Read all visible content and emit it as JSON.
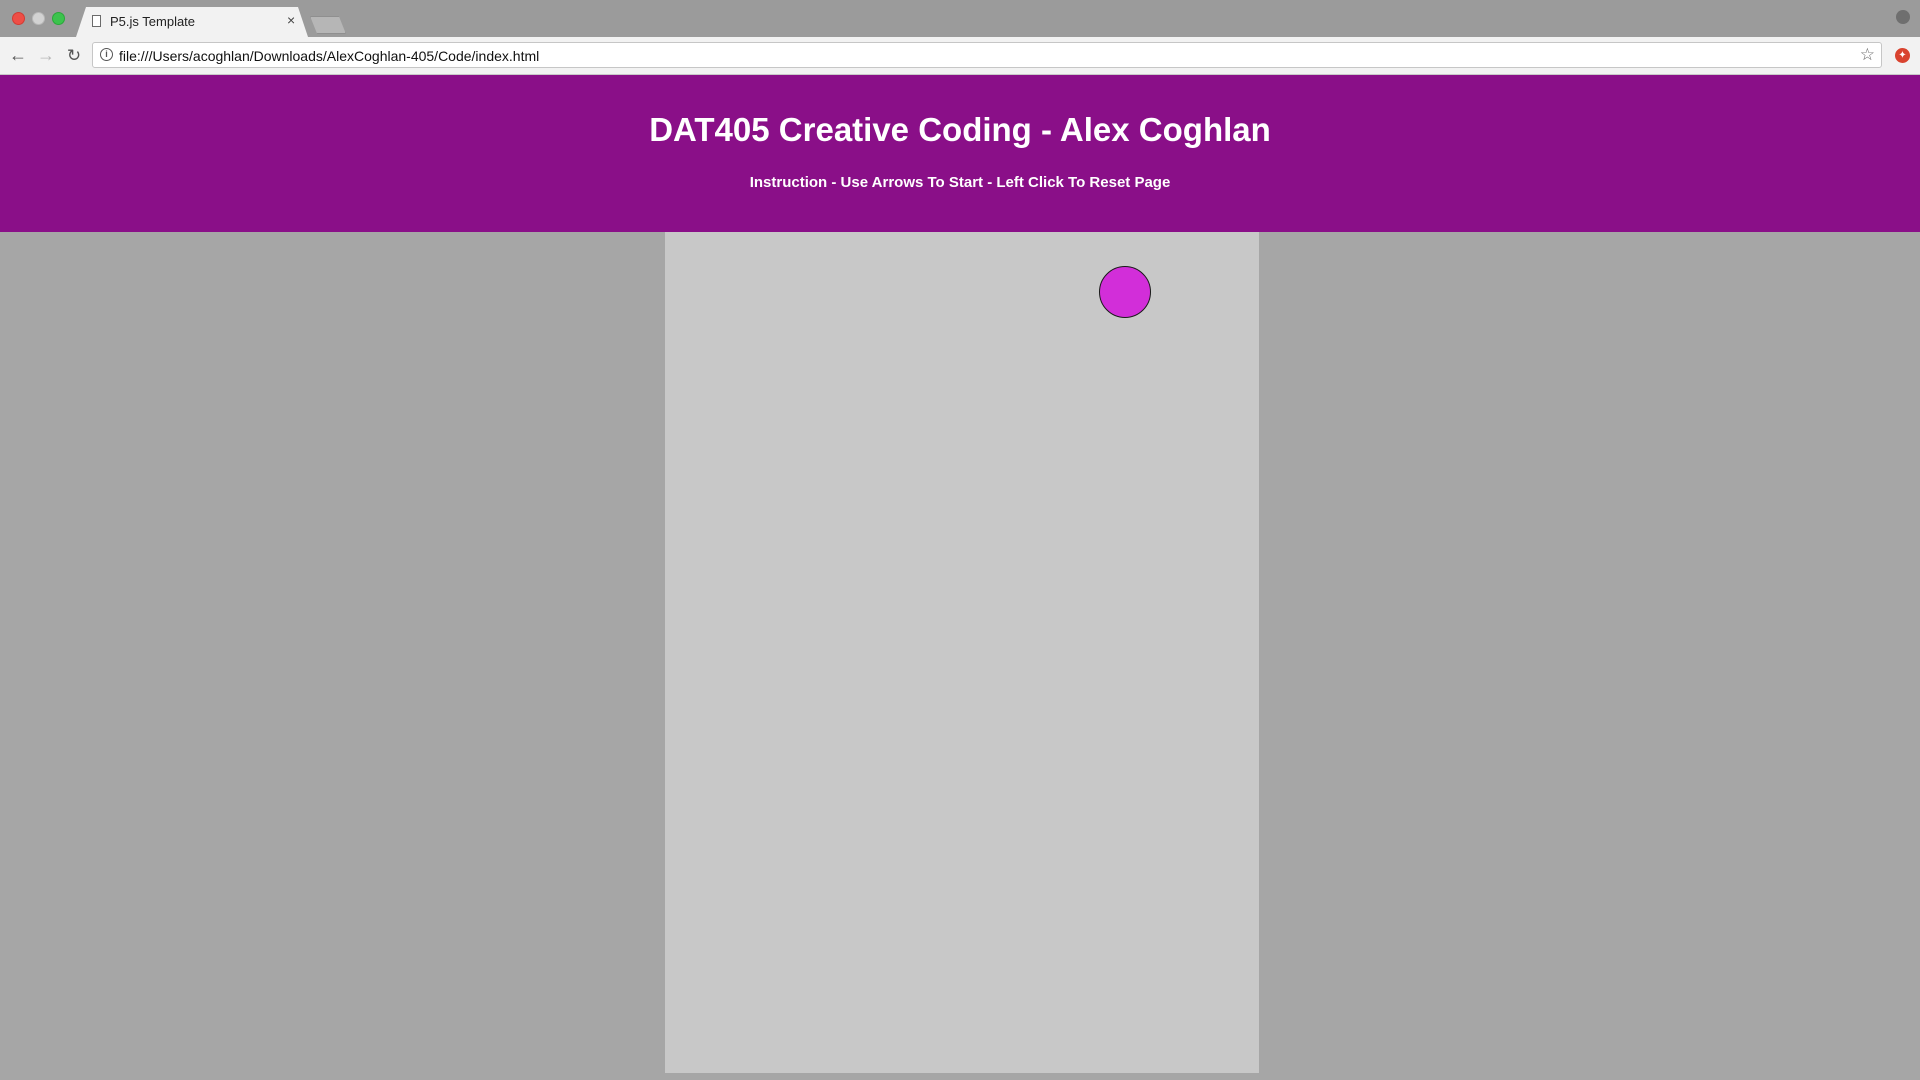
{
  "browser": {
    "tab": {
      "title": "P5.js Template",
      "close_glyph": "×",
      "icon": "document-icon"
    },
    "toolbar": {
      "back_glyph": "←",
      "forward_glyph": "→",
      "reload_glyph": "↻",
      "url": "file:///Users/acoghlan/Downloads/AlexCoghlan-405/Code/index.html",
      "info_glyph": "i",
      "star_glyph": "☆",
      "extension_glyph": "✦"
    },
    "colors": {
      "traffic_close": "#ee4e46",
      "traffic_min": "#d2d2d2",
      "traffic_max": "#3cc34d"
    }
  },
  "page": {
    "header": {
      "title": "DAT405 Creative Coding - Alex Coghlan",
      "instructions": "Instruction - Use Arrows To Start - Left Click To Reset Page",
      "background": "#8a0f88"
    },
    "canvas": {
      "background": "#c8c8c8",
      "ball_color": "#d22ed9"
    }
  }
}
